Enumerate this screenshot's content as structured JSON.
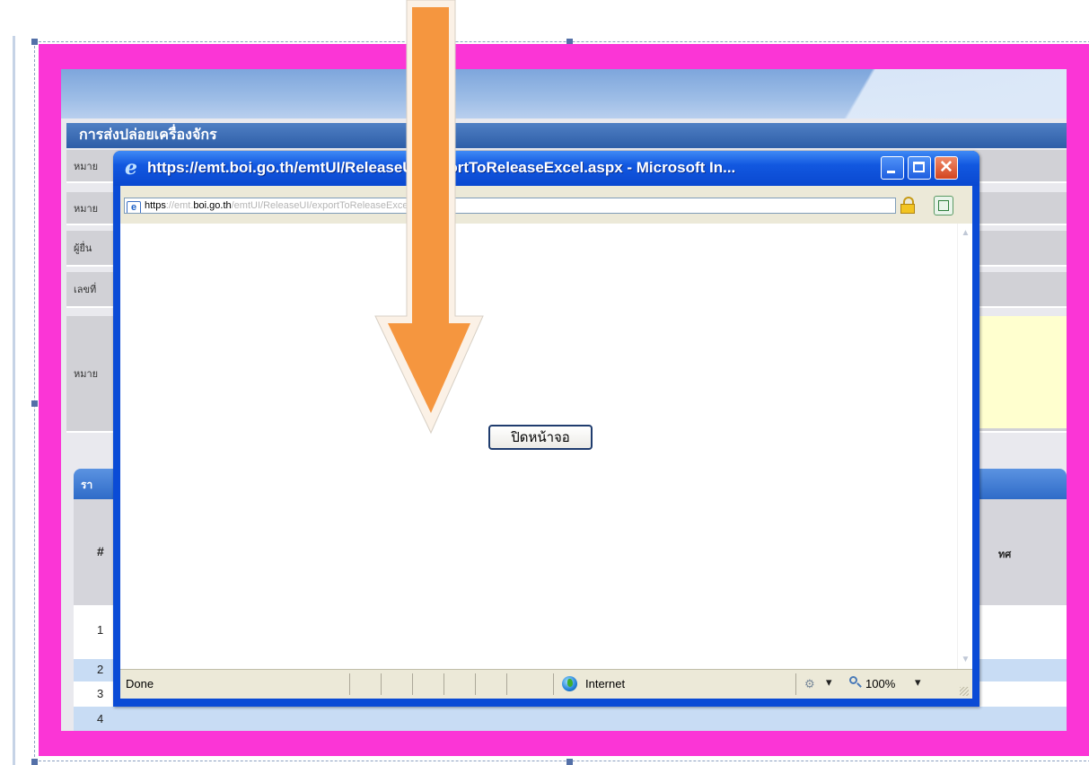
{
  "background_page": {
    "section_title": "การส่งปล่อยเครื่องจักร",
    "row_labels": [
      "หมาย",
      "หมาย",
      "ผู้ยื่น",
      "เลขที่",
      "หมาย"
    ],
    "tab_label": "รา",
    "table": {
      "header_symbol": "#",
      "header_partial": "ทศ",
      "row_numbers": [
        "1",
        "2",
        "3",
        "4"
      ]
    }
  },
  "popup_window": {
    "title": "https://emt.boi.go.th/emtUI/ReleaseUI/exportToReleaseExcel.aspx - Microsoft In...",
    "address": {
      "scheme": "https",
      "sep": "://emt.",
      "domain": "boi.go.th",
      "path": "/emtUI/ReleaseUI/exportToReleaseExcel.aspx"
    },
    "close_button_label": "ปิดหน้าจอ",
    "status": {
      "done": "Done",
      "zone": "Internet",
      "zoom": "100%",
      "dropdown_glyph": "▾"
    }
  },
  "colors": {
    "frame": "#fb35d6",
    "arrow": "#f5963f",
    "titlebar": "#0a48d0"
  }
}
